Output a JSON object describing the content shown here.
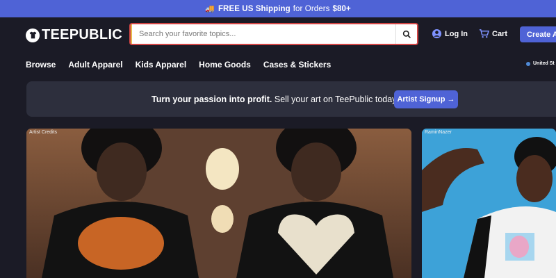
{
  "promo": {
    "icon": "truck-icon",
    "bold_lead": "FREE US Shipping",
    "middle": "for Orders",
    "bold_tail": "$80+"
  },
  "header": {
    "logo_text": "TEEPUBLIC",
    "search_placeholder": "Search your favorite topics...",
    "login_label": "Log In",
    "cart_label": "Cart",
    "create_label": "Create Ac"
  },
  "nav": {
    "items": [
      "Browse",
      "Adult Apparel",
      "Kids Apparel",
      "Home Goods",
      "Cases & Stickers"
    ],
    "region": "United St"
  },
  "banner": {
    "strong": "Turn your passion into profit.",
    "rest": "Sell your art on TeePublic today!",
    "button": "Artist Signup →"
  },
  "cards": [
    {
      "credit": "Artist Credits"
    },
    {
      "credit": "RaminNazer"
    }
  ],
  "colors": {
    "accent": "#4f63d6",
    "background": "#1b1b26",
    "banner": "#2d2f3d",
    "search_border": "#d24545"
  }
}
